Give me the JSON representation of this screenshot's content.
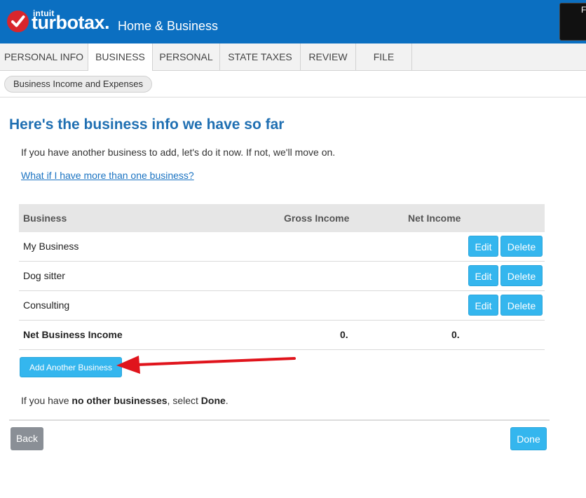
{
  "header": {
    "intuit": "intuit",
    "brand": "turbotax.",
    "edition": "Home & Business",
    "corner_label": "F",
    "brand_color": "#0b6fc1",
    "check_color": "#d8262c"
  },
  "tabs": [
    {
      "label": "PERSONAL INFO",
      "active": false
    },
    {
      "label": "BUSINESS",
      "active": true
    },
    {
      "label": "PERSONAL",
      "active": false
    },
    {
      "label": "STATE TAXES",
      "active": false
    },
    {
      "label": "REVIEW",
      "active": false
    },
    {
      "label": "FILE",
      "active": false
    }
  ],
  "breadcrumb": "Business Income and Expenses",
  "main": {
    "title": "Here's the business info we have so far",
    "intro": "If you have another business to add, let's do it now. If not, we'll move on.",
    "help_link": "What if I have more than one business?"
  },
  "table": {
    "headers": {
      "business": "Business",
      "gross": "Gross Income",
      "net": "Net Income"
    },
    "rows": [
      {
        "name": "My Business",
        "edit": "Edit",
        "delete": "Delete"
      },
      {
        "name": "Dog sitter",
        "edit": "Edit",
        "delete": "Delete"
      },
      {
        "name": "Consulting",
        "edit": "Edit",
        "delete": "Delete"
      }
    ],
    "total": {
      "label": "Net Business Income",
      "gross": "0.",
      "net": "0."
    }
  },
  "add_button": "Add Another Business",
  "done_note": {
    "prefix": "If you have ",
    "strong1": "no other businesses",
    "middle": ", select ",
    "strong2": "Done",
    "suffix": "."
  },
  "footer": {
    "back": "Back",
    "done": "Done"
  },
  "colors": {
    "accent_button": "#34b6ee",
    "back_button": "#8a8f96",
    "title": "#1f6fb2",
    "annotation_arrow": "#e0141c"
  }
}
